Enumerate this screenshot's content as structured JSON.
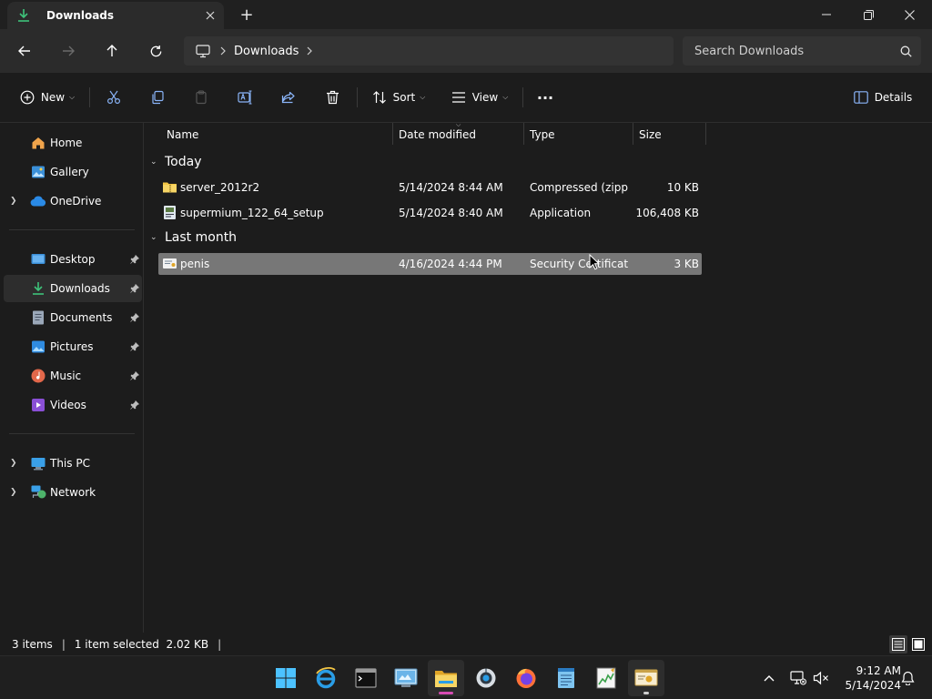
{
  "window": {
    "tab_title": "Downloads",
    "new_tab": "+"
  },
  "address": {
    "crumbs": [
      "Downloads"
    ],
    "search_placeholder": "Search Downloads"
  },
  "toolbar": {
    "new_label": "New",
    "sort_label": "Sort",
    "view_label": "View",
    "more_label": "···",
    "details_label": "Details"
  },
  "sidebar": {
    "items": [
      {
        "label": "Home",
        "icon": "home-icon"
      },
      {
        "label": "Gallery",
        "icon": "gallery-icon"
      },
      {
        "label": "OneDrive",
        "icon": "cloud-icon"
      },
      {
        "label": "Desktop",
        "icon": "desktop-icon"
      },
      {
        "label": "Downloads",
        "icon": "download-icon"
      },
      {
        "label": "Documents",
        "icon": "documents-icon"
      },
      {
        "label": "Pictures",
        "icon": "pictures-icon"
      },
      {
        "label": "Music",
        "icon": "music-icon"
      },
      {
        "label": "Videos",
        "icon": "videos-icon"
      },
      {
        "label": "This PC",
        "icon": "pc-icon"
      },
      {
        "label": "Network",
        "icon": "network-icon"
      }
    ],
    "active": "Downloads"
  },
  "columns": {
    "name": "Name",
    "date": "Date modified",
    "type": "Type",
    "size": "Size"
  },
  "groups": [
    {
      "name": "Today",
      "files": [
        {
          "name": "server_2012r2",
          "date": "5/14/2024 8:44 AM",
          "type": "Compressed (zipp...",
          "size": "10 KB",
          "icon": "zip-folder-icon"
        },
        {
          "name": "supermium_122_64_setup",
          "date": "5/14/2024 8:40 AM",
          "type": "Application",
          "size": "106,408 KB",
          "icon": "installer-icon"
        }
      ]
    },
    {
      "name": "Last month",
      "files": [
        {
          "name": "penis",
          "date": "4/16/2024 4:44 PM",
          "type": "Security Certificate",
          "size": "3 KB",
          "icon": "certificate-icon",
          "selected": true
        }
      ]
    }
  ],
  "status": {
    "item_count": "3 items",
    "selection": "1 item selected  2.02 KB"
  },
  "clock": {
    "time": "9:12 AM",
    "date": "5/14/2024"
  },
  "colors": {
    "accent": "#60cdff",
    "folder": "#f3c544",
    "selection": "#777777",
    "taskbar_indicator": "#d64bb3"
  }
}
